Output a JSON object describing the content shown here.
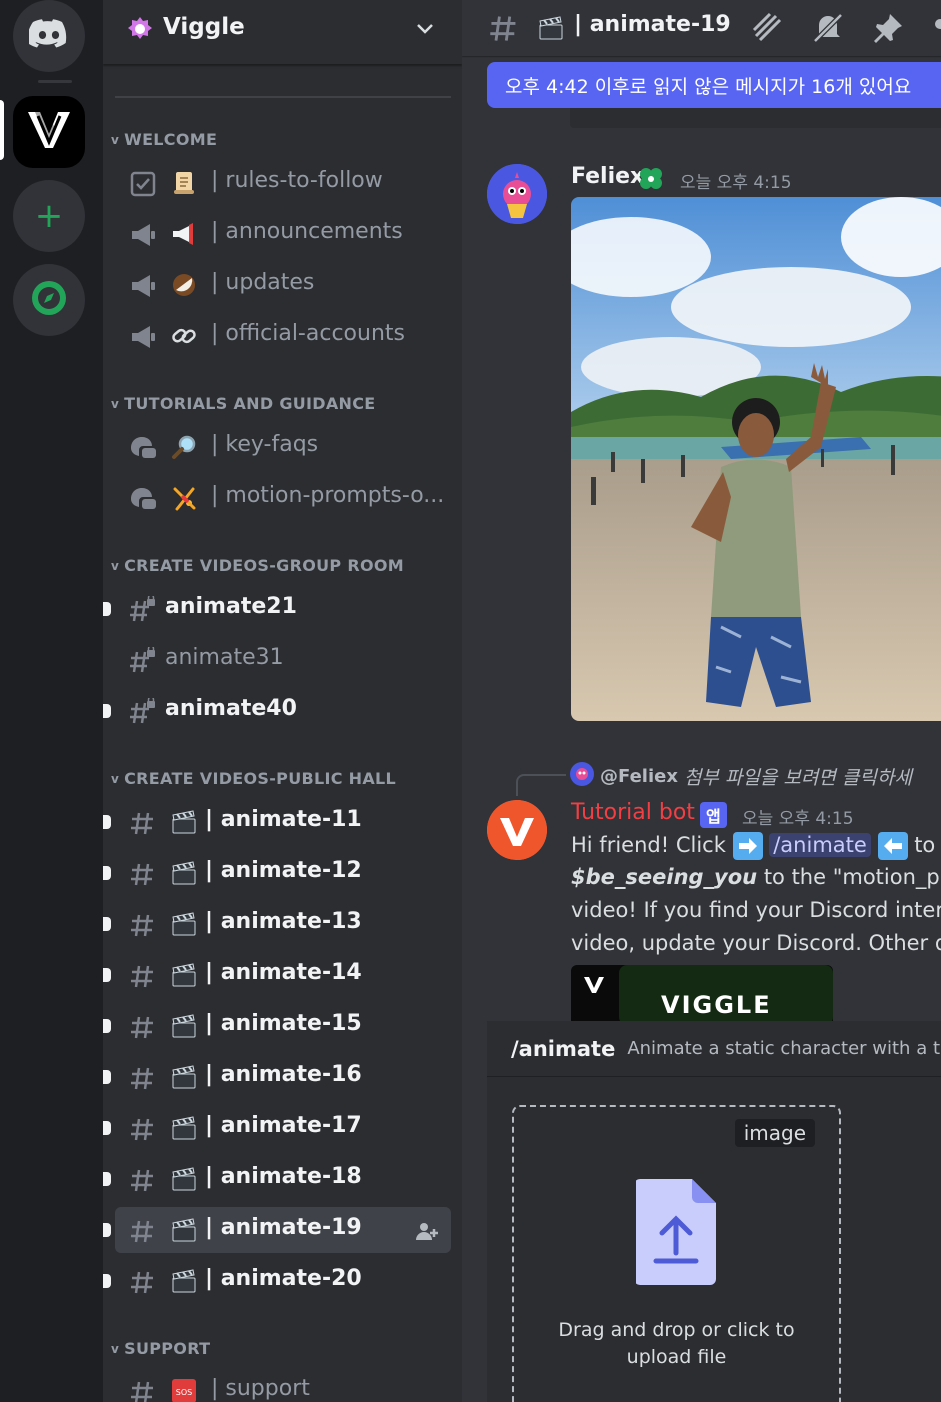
{
  "server": {
    "name": "Viggle"
  },
  "categories": {
    "welcome": "WELCOME",
    "tutorials": "TUTORIALS AND GUIDANCE",
    "group_room": "CREATE VIDEOS-GROUP ROOM",
    "public_hall": "CREATE VIDEOS-PUBLIC HALL",
    "support": "SUPPORT"
  },
  "channels": {
    "welcome": [
      {
        "label": "| rules-to-follow"
      },
      {
        "label": "| announcements"
      },
      {
        "label": "| updates"
      },
      {
        "label": "| official-accounts"
      }
    ],
    "tutorials": [
      {
        "label": "| key-faqs"
      },
      {
        "label": "| motion-prompts-o..."
      }
    ],
    "group_room": [
      {
        "label": "animate21"
      },
      {
        "label": "animate31"
      },
      {
        "label": "animate40"
      }
    ],
    "public_hall": [
      {
        "label": "| animate-11"
      },
      {
        "label": "| animate-12"
      },
      {
        "label": "| animate-13"
      },
      {
        "label": "| animate-14"
      },
      {
        "label": "| animate-15"
      },
      {
        "label": "| animate-16"
      },
      {
        "label": "| animate-17"
      },
      {
        "label": "| animate-18"
      },
      {
        "label": "| animate-19"
      },
      {
        "label": "| animate-20"
      }
    ],
    "support": [
      {
        "label": "| support"
      }
    ]
  },
  "topbar": {
    "title": "| animate-19"
  },
  "new_messages_bar": "오후 4:42 이후로 읽지 않은 메시지가 16개 있어요",
  "messages": {
    "m1": {
      "author": "Feliex",
      "time": "오늘 오후 4:15"
    },
    "m2": {
      "reply_author": "@Feliex",
      "reply_text": "첨부 파일을 보려면 클릭하세",
      "author": "Tutorial bot",
      "app_badge": "앱",
      "time": "오늘 오후 4:15",
      "line1_a": "Hi friend! Click",
      "line1_cmd": "/animate",
      "line1_b": "to u",
      "line2_bold": "$be_seeing_you",
      "line2_rest": "to the \"motion_pro",
      "line3": "video! If you find your Discord interfa",
      "line4": "video, update your Discord. Other qu",
      "embed_brand": "VIGGLE"
    }
  },
  "command": {
    "name": "/animate",
    "description": "Animate a static character with a te",
    "option_chip": "image",
    "dropzone_text_1": "Drag and drop or click to",
    "dropzone_text_2": "upload file"
  },
  "colors": {
    "blurple": "#5865f2",
    "bot_name": "#f23f43",
    "green_add": "#23a559"
  }
}
